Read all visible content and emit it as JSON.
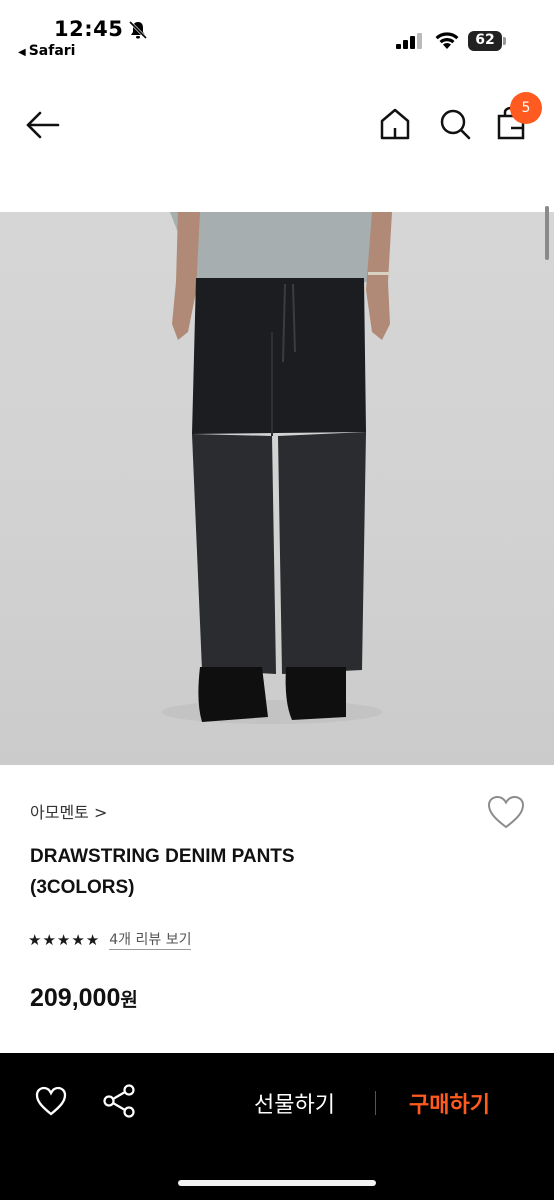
{
  "status_bar": {
    "time": "12:45",
    "back_app": "Safari",
    "battery": "62"
  },
  "nav": {
    "cart_count": "5"
  },
  "product": {
    "brand": "아모멘토",
    "brand_chevron": ">",
    "title_line1": "DRAWSTRING DENIM PANTS",
    "title_line2": "(3COLORS)",
    "rating_stars": 5,
    "review_link": "4개 리뷰 보기",
    "price_number": "209,000",
    "price_unit": "원"
  },
  "bottom_bar": {
    "gift_label": "선물하기",
    "buy_label": "구매하기"
  },
  "colors": {
    "accent": "#ff5a1f",
    "bottom_bar": "#000000"
  },
  "icons": [
    "bell-slash-icon",
    "signal-icon",
    "wifi-icon",
    "battery-icon",
    "arrow-left-icon",
    "home-icon",
    "search-icon",
    "shopping-bag-icon",
    "heart-outline-icon",
    "star-icon",
    "share-icon"
  ]
}
